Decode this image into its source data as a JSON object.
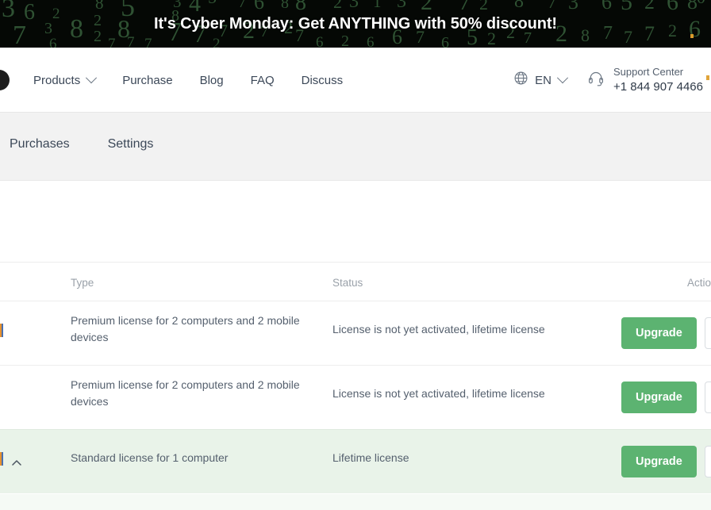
{
  "promo_banner": {
    "text": "It's Cyber Monday: Get ANYTHING with 50% discount!",
    "background_color": "#050805",
    "digit_color": "#2f5233",
    "text_color": "#ffffff"
  },
  "nav": {
    "links": [
      {
        "label": "Products",
        "has_dropdown": true,
        "icon": "chevron-down-icon"
      },
      {
        "label": "Purchase",
        "has_dropdown": false
      },
      {
        "label": "Blog",
        "has_dropdown": false
      },
      {
        "label": "FAQ",
        "has_dropdown": false
      },
      {
        "label": "Discuss",
        "has_dropdown": false
      }
    ],
    "language": {
      "icon": "globe-icon",
      "code": "EN",
      "chevron": "chevron-down-icon"
    },
    "support": {
      "icon": "headset-icon",
      "title": "Support Center",
      "phone": "+1 844 907 4466"
    }
  },
  "tabs": [
    {
      "label": "Purchases",
      "active": false
    },
    {
      "label": "Settings",
      "active": false
    }
  ],
  "table": {
    "columns": [
      "Type",
      "Status",
      "Actions"
    ],
    "header_type": "Type",
    "header_status": "Status",
    "header_action": "Actions",
    "rows": [
      {
        "type": "Premium license for 2 computers and 2 mobile devices",
        "status": "License is not yet activated, lifetime license",
        "action_label": "Upgrade",
        "highlighted": false,
        "expanded": false
      },
      {
        "type": "Premium license for 2 computers and 2 mobile devices",
        "status": "License is not yet activated, lifetime license",
        "action_label": "Upgrade",
        "highlighted": false,
        "expanded": false
      },
      {
        "type": "Standard license for 1 computer",
        "status": "Lifetime license",
        "action_label": "Upgrade",
        "highlighted": true,
        "expanded": true,
        "collapse_icon": "chevron-up-icon"
      }
    ]
  },
  "colors": {
    "accent_green": "#5cb371",
    "row_highlight": "#e9f3e9",
    "tabbar_background": "#f2f2f2",
    "text_primary": "#3c4858",
    "text_secondary": "#55606e",
    "text_muted": "#9aa1a9"
  }
}
